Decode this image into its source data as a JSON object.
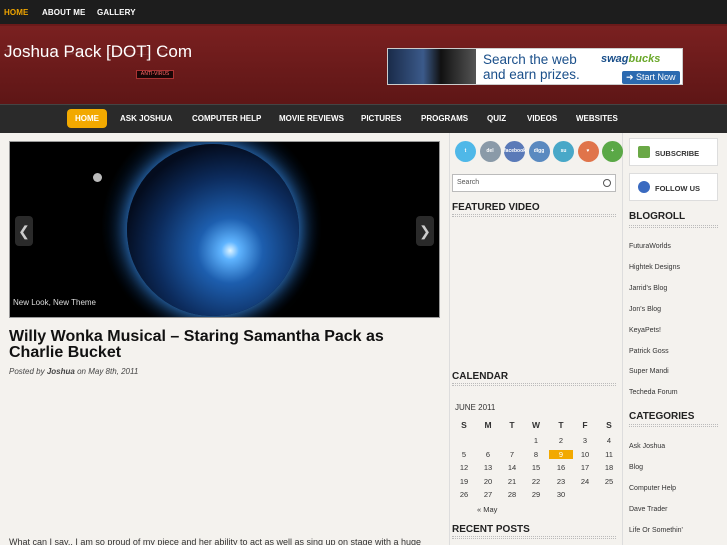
{
  "top_nav": [
    "HOME",
    "ABOUT ME",
    "GALLERY"
  ],
  "site": {
    "title": "Joshua Pack [DOT] Com",
    "stamp": "ANTI-VIRUS"
  },
  "ad": {
    "line1": "Search the web",
    "line2": "and earn prizes.",
    "brand_a": "swag",
    "brand_b": "bucks",
    "cta": "Start Now"
  },
  "main_nav": [
    "HOME",
    "ASK JOSHUA",
    "COMPUTER HELP",
    "MOVIE REVIEWS",
    "PICTURES",
    "PROGRAMS",
    "QUIZ",
    "VIDEOS",
    "WEBSITES"
  ],
  "slider": {
    "caption": "New Look, New Theme",
    "prev": "❮",
    "next": "❯"
  },
  "post": {
    "title": "Willy Wonka Musical – Staring Samantha Pack as Charlie Bucket",
    "meta_prefix": "Posted by",
    "author": "Joshua",
    "meta_mid": "on",
    "date": "May 8th, 2011",
    "excerpt": "What can I say.. I am so proud of my piece and her ability to act as well as sing up on stage with a huge"
  },
  "social": [
    {
      "name": "twitter",
      "label": "t",
      "color": "#4fb8e8"
    },
    {
      "name": "delicious",
      "label": "del",
      "color": "#8a9aa8"
    },
    {
      "name": "facebook",
      "label": "facebook",
      "color": "#5a7ab8"
    },
    {
      "name": "digg",
      "label": "digg",
      "color": "#5a8ac0"
    },
    {
      "name": "stumbleupon",
      "label": "su",
      "color": "#48a8c8"
    },
    {
      "name": "favorite",
      "label": "♥",
      "color": "#e0744a"
    },
    {
      "name": "add",
      "label": "+",
      "color": "#5aa846"
    }
  ],
  "search": {
    "placeholder": "Search"
  },
  "widgets": {
    "featured_video": "FEATURED VIDEO",
    "calendar": "CALENDAR",
    "recent_posts": "RECENT POSTS",
    "blogroll": "BLOGROLL",
    "categories": "CATEGORIES"
  },
  "calendar": {
    "month": "JUNE 2011",
    "days": [
      "S",
      "M",
      "T",
      "W",
      "T",
      "F",
      "S"
    ],
    "weeks": [
      [
        "",
        "",
        "",
        "1",
        "2",
        "3",
        "4"
      ],
      [
        "5",
        "6",
        "7",
        "8",
        "9",
        "10",
        "11"
      ],
      [
        "12",
        "13",
        "14",
        "15",
        "16",
        "17",
        "18"
      ],
      [
        "19",
        "20",
        "21",
        "22",
        "23",
        "24",
        "25"
      ],
      [
        "26",
        "27",
        "28",
        "29",
        "30",
        "",
        ""
      ]
    ],
    "today": "9",
    "prev": "« May"
  },
  "buttons": {
    "subscribe": "SUBSCRIBE",
    "follow": "FOLLOW US"
  },
  "blogroll": [
    "FuturaWorlds",
    "Hightek Designs",
    "Jarrid's Blog",
    "Jon's Blog",
    "KeyaPets!",
    "Patrick Goss",
    "Super Mandi",
    "Techeda Forum"
  ],
  "categories": [
    "Ask Joshua",
    "Blog",
    "Computer Help",
    "Dave Trader",
    "Life Or Somethin'"
  ]
}
